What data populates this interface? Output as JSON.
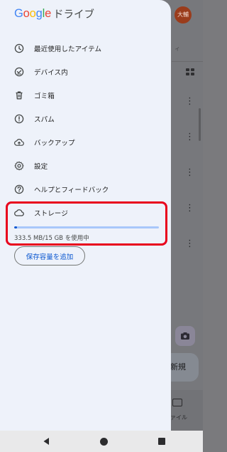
{
  "background": {
    "avatar_text": "大輔",
    "tab_fragment": "ィ",
    "fab_label": "新規",
    "bottom_tab_label": "ァイル"
  },
  "drawer": {
    "logo": [
      "G",
      "o",
      "o",
      "g",
      "l",
      "e"
    ],
    "app_name": "ドライブ",
    "items": [
      {
        "label": "最近使用したアイテム",
        "icon": "clock-icon"
      },
      {
        "label": "デバイス内",
        "icon": "offline-check-icon"
      },
      {
        "label": "ゴミ箱",
        "icon": "trash-icon"
      },
      {
        "label": "スパム",
        "icon": "spam-icon"
      },
      {
        "label": "バックアップ",
        "icon": "cloud-upload-icon"
      },
      {
        "label": "設定",
        "icon": "gear-icon"
      },
      {
        "label": "ヘルプとフィードバック",
        "icon": "help-icon"
      },
      {
        "label": "ストレージ",
        "icon": "cloud-icon"
      }
    ],
    "storage": {
      "usage_text": "333.5 MB/15 GB を使用中",
      "used_fraction": 0.022
    },
    "buy_storage_label": "保存容量を追加"
  },
  "colors": {
    "highlight": "#e8001c",
    "accent": "#0b57d0",
    "drawer_bg": "#eef2fa"
  }
}
